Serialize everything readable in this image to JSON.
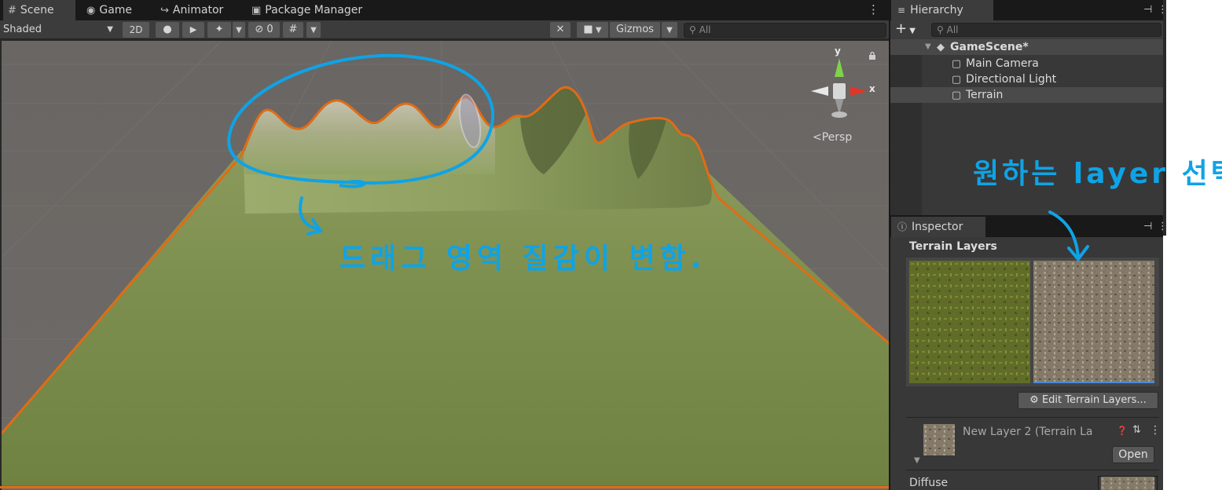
{
  "scene_tabs": [
    {
      "label": "Scene",
      "icon": "grid-icon"
    },
    {
      "label": "Game",
      "icon": "gamepad-icon"
    },
    {
      "label": "Animator",
      "icon": "animator-icon"
    },
    {
      "label": "Package Manager",
      "icon": "package-icon"
    }
  ],
  "toolbar": {
    "shading_mode": "Shaded",
    "mode_2d": "2D",
    "hidden_count": "0",
    "gizmos_label": "Gizmos",
    "search_placeholder": "All"
  },
  "viewport": {
    "gizmo_y_label": "y",
    "gizmo_x_label": "x",
    "projection_label": "<Persp",
    "annotation_drag": "드래그 영역 질감이 변함.",
    "annotation_select": "원하는 layer 선택"
  },
  "hierarchy": {
    "tab_label": "Hierarchy",
    "search_placeholder": "All",
    "scene_name": "GameScene*",
    "objects": [
      "Main Camera",
      "Directional Light",
      "Terrain"
    ]
  },
  "inspector": {
    "tab_label": "Inspector",
    "section_title": "Terrain Layers",
    "edit_button_label": "Edit Terrain Layers...",
    "layer_name": "New Layer 2 (Terrain La",
    "open_button_label": "Open",
    "diffuse_label": "Diffuse"
  },
  "colors": {
    "selection_outline": "#e06c15",
    "annotation": "#0fa3e6",
    "terrain": "#7a8c4c"
  }
}
